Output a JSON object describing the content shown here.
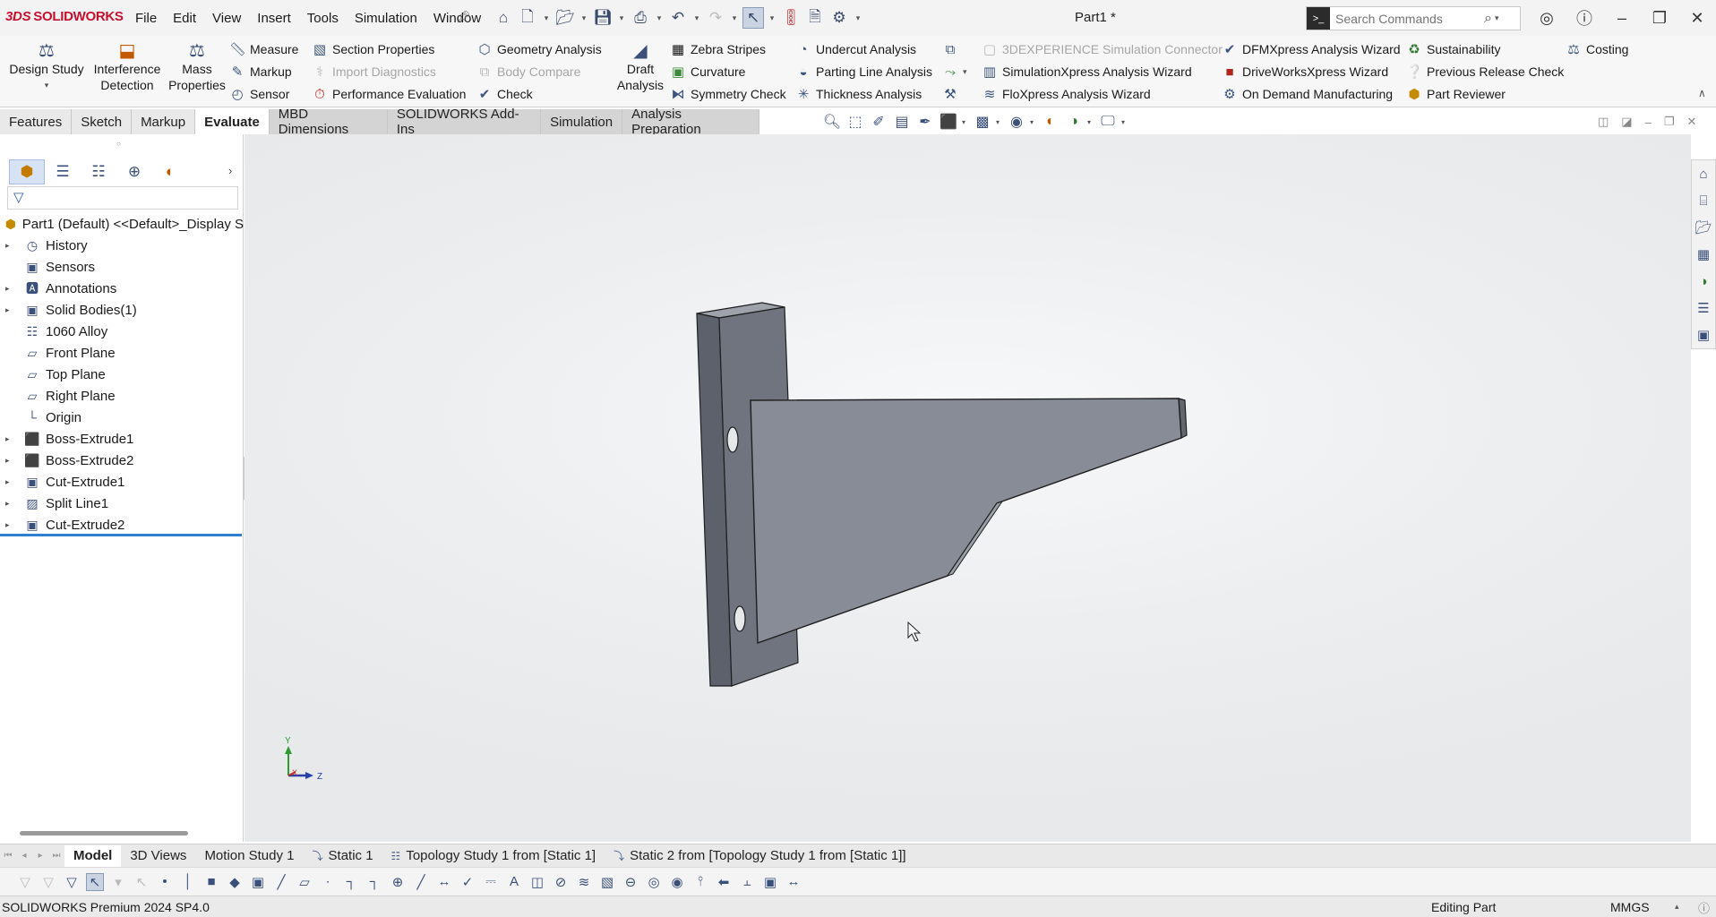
{
  "app": {
    "brand": "SOLIDWORKS",
    "document_title": "Part1 *"
  },
  "menu": [
    "File",
    "Edit",
    "View",
    "Insert",
    "Tools",
    "Simulation",
    "Window"
  ],
  "search": {
    "placeholder": "Search Commands"
  },
  "ribbon": {
    "design_study": "Design Study",
    "interference_detection": [
      "Interference",
      "Detection"
    ],
    "mass_properties": [
      "Mass",
      "Properties"
    ],
    "draft_analysis": [
      "Draft",
      "Analysis"
    ],
    "measure": "Measure",
    "markup": "Markup",
    "sensor": "Sensor",
    "section_properties": "Section Properties",
    "import_diagnostics": "Import Diagnostics",
    "performance_evaluation": "Performance Evaluation",
    "geometry_analysis": "Geometry Analysis",
    "body_compare": "Body Compare",
    "check": "Check",
    "zebra_stripes": "Zebra Stripes",
    "curvature": "Curvature",
    "symmetry_check": "Symmetry Check",
    "undercut_analysis": "Undercut Analysis",
    "parting_line_analysis": "Parting Line Analysis",
    "thickness_analysis": "Thickness Analysis",
    "experience_connector": "3DEXPERIENCE Simulation Connector",
    "simulationxpress": "SimulationXpress Analysis Wizard",
    "floxpress": "FloXpress Analysis Wizard",
    "dfmxpress": "DFMXpress Analysis Wizard",
    "driveworksxpress": "DriveWorksXpress Wizard",
    "on_demand": "On Demand Manufacturing",
    "sustainability": "Sustainability",
    "previous_release_check": "Previous Release Check",
    "part_reviewer": "Part Reviewer",
    "costing": "Costing"
  },
  "tabs": [
    "Features",
    "Sketch",
    "Markup",
    "Evaluate",
    "MBD Dimensions",
    "SOLIDWORKS Add-Ins",
    "Simulation",
    "Analysis Preparation"
  ],
  "active_tab": "Evaluate",
  "tree": {
    "root": "Part1 (Default) <<Default>_Display S",
    "items": [
      {
        "label": "History",
        "icon": "history-icon",
        "expandable": true
      },
      {
        "label": "Sensors",
        "icon": "sensors-icon",
        "expandable": false
      },
      {
        "label": "Annotations",
        "icon": "annotations-icon",
        "expandable": true
      },
      {
        "label": "Solid Bodies(1)",
        "icon": "solid-bodies-icon",
        "expandable": true
      },
      {
        "label": "1060 Alloy",
        "icon": "material-icon",
        "expandable": false
      },
      {
        "label": "Front Plane",
        "icon": "plane-icon",
        "expandable": false
      },
      {
        "label": "Top Plane",
        "icon": "plane-icon",
        "expandable": false
      },
      {
        "label": "Right Plane",
        "icon": "plane-icon",
        "expandable": false
      },
      {
        "label": "Origin",
        "icon": "origin-icon",
        "expandable": false
      },
      {
        "label": "Boss-Extrude1",
        "icon": "boss-extrude-icon",
        "expandable": true
      },
      {
        "label": "Boss-Extrude2",
        "icon": "boss-extrude-icon",
        "expandable": true
      },
      {
        "label": "Cut-Extrude1",
        "icon": "cut-extrude-icon",
        "expandable": true
      },
      {
        "label": "Split Line1",
        "icon": "split-line-icon",
        "expandable": true
      },
      {
        "label": "Cut-Extrude2",
        "icon": "cut-extrude-icon",
        "expandable": true
      }
    ]
  },
  "triad": {
    "y": "Y",
    "x": "X",
    "z": "Z"
  },
  "bottom_tabs": [
    "Model",
    "3D Views",
    "Motion Study 1",
    "Static 1",
    "Topology Study 1 from [Static 1]",
    "Static 2 from [Topology Study 1 from [Static 1]]"
  ],
  "status": {
    "product": "SOLIDWORKS Premium 2024 SP4.0",
    "mode": "Editing Part",
    "units": "MMGS"
  },
  "colors": {
    "brand_red": "#c8102e",
    "selection_blue": "#2f7fd1",
    "part_face": "#878c96",
    "part_edge": "#1e1e1e"
  }
}
